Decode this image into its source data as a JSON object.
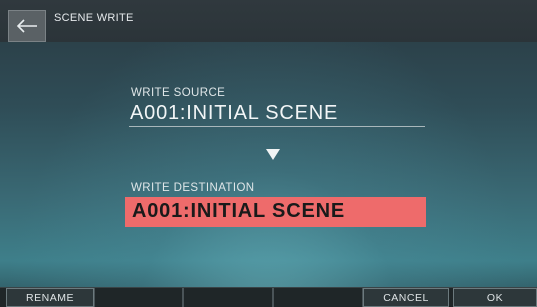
{
  "window": {
    "title": "SCENE WRITE"
  },
  "source": {
    "label": "WRITE SOURCE",
    "value": "A001:INITIAL SCENE"
  },
  "destination": {
    "label": "WRITE DESTINATION",
    "value": "A001:INITIAL SCENE",
    "highlight_color": "#ee6b6b"
  },
  "bottom_bar": {
    "rename": "RENAME",
    "cancel": "CANCEL",
    "ok": "OK"
  },
  "icons": {
    "back": "back-arrow-icon",
    "down": "down-triangle-icon"
  }
}
